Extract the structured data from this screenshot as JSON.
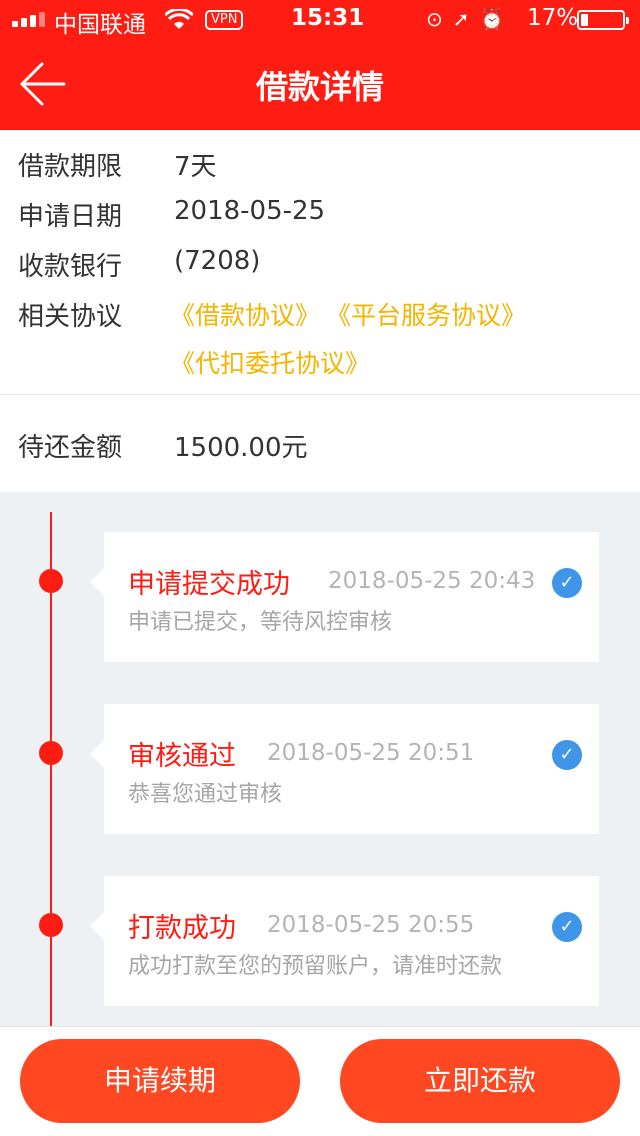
{
  "status_bar": {
    "carrier": "中国联通",
    "vpn": "VPN",
    "time": "15:31",
    "battery": "17%",
    "battery_level": 0.17,
    "icons": [
      "signal-icon",
      "wifi-icon",
      "rotation-lock-icon",
      "location-icon",
      "alarm-icon",
      "battery-icon"
    ]
  },
  "header": {
    "title": "借款详情"
  },
  "details": {
    "term_label": "借款期限",
    "term_value": "7天",
    "date_label": "申请日期",
    "date_value": "2018-05-25",
    "bank_label": "收款银行",
    "bank_value": "(7208)",
    "agreements_label": "相关协议",
    "agreements": [
      "《借款协议》",
      "《平台服务协议》",
      "《代扣委托协议》"
    ],
    "amount_label": "待还金额",
    "amount_value": "1500.00元"
  },
  "timeline": [
    {
      "title": "申请提交成功",
      "time": "2018-05-25 20:43",
      "desc": "申请已提交，等待风控审核"
    },
    {
      "title": "审核通过",
      "time": "2018-05-25 20:51",
      "desc": "恭喜您通过审核"
    },
    {
      "title": "打款成功",
      "time": "2018-05-25 20:55",
      "desc": "成功打款至您的预留账户，请准时还款"
    }
  ],
  "buttons": {
    "renew": "申请续期",
    "repay": "立即还款"
  },
  "colors": {
    "brand_red": "#ff1c12",
    "button_orange": "#ff4722",
    "link_yellow": "#f4b400",
    "check_blue": "#3f95e8"
  }
}
